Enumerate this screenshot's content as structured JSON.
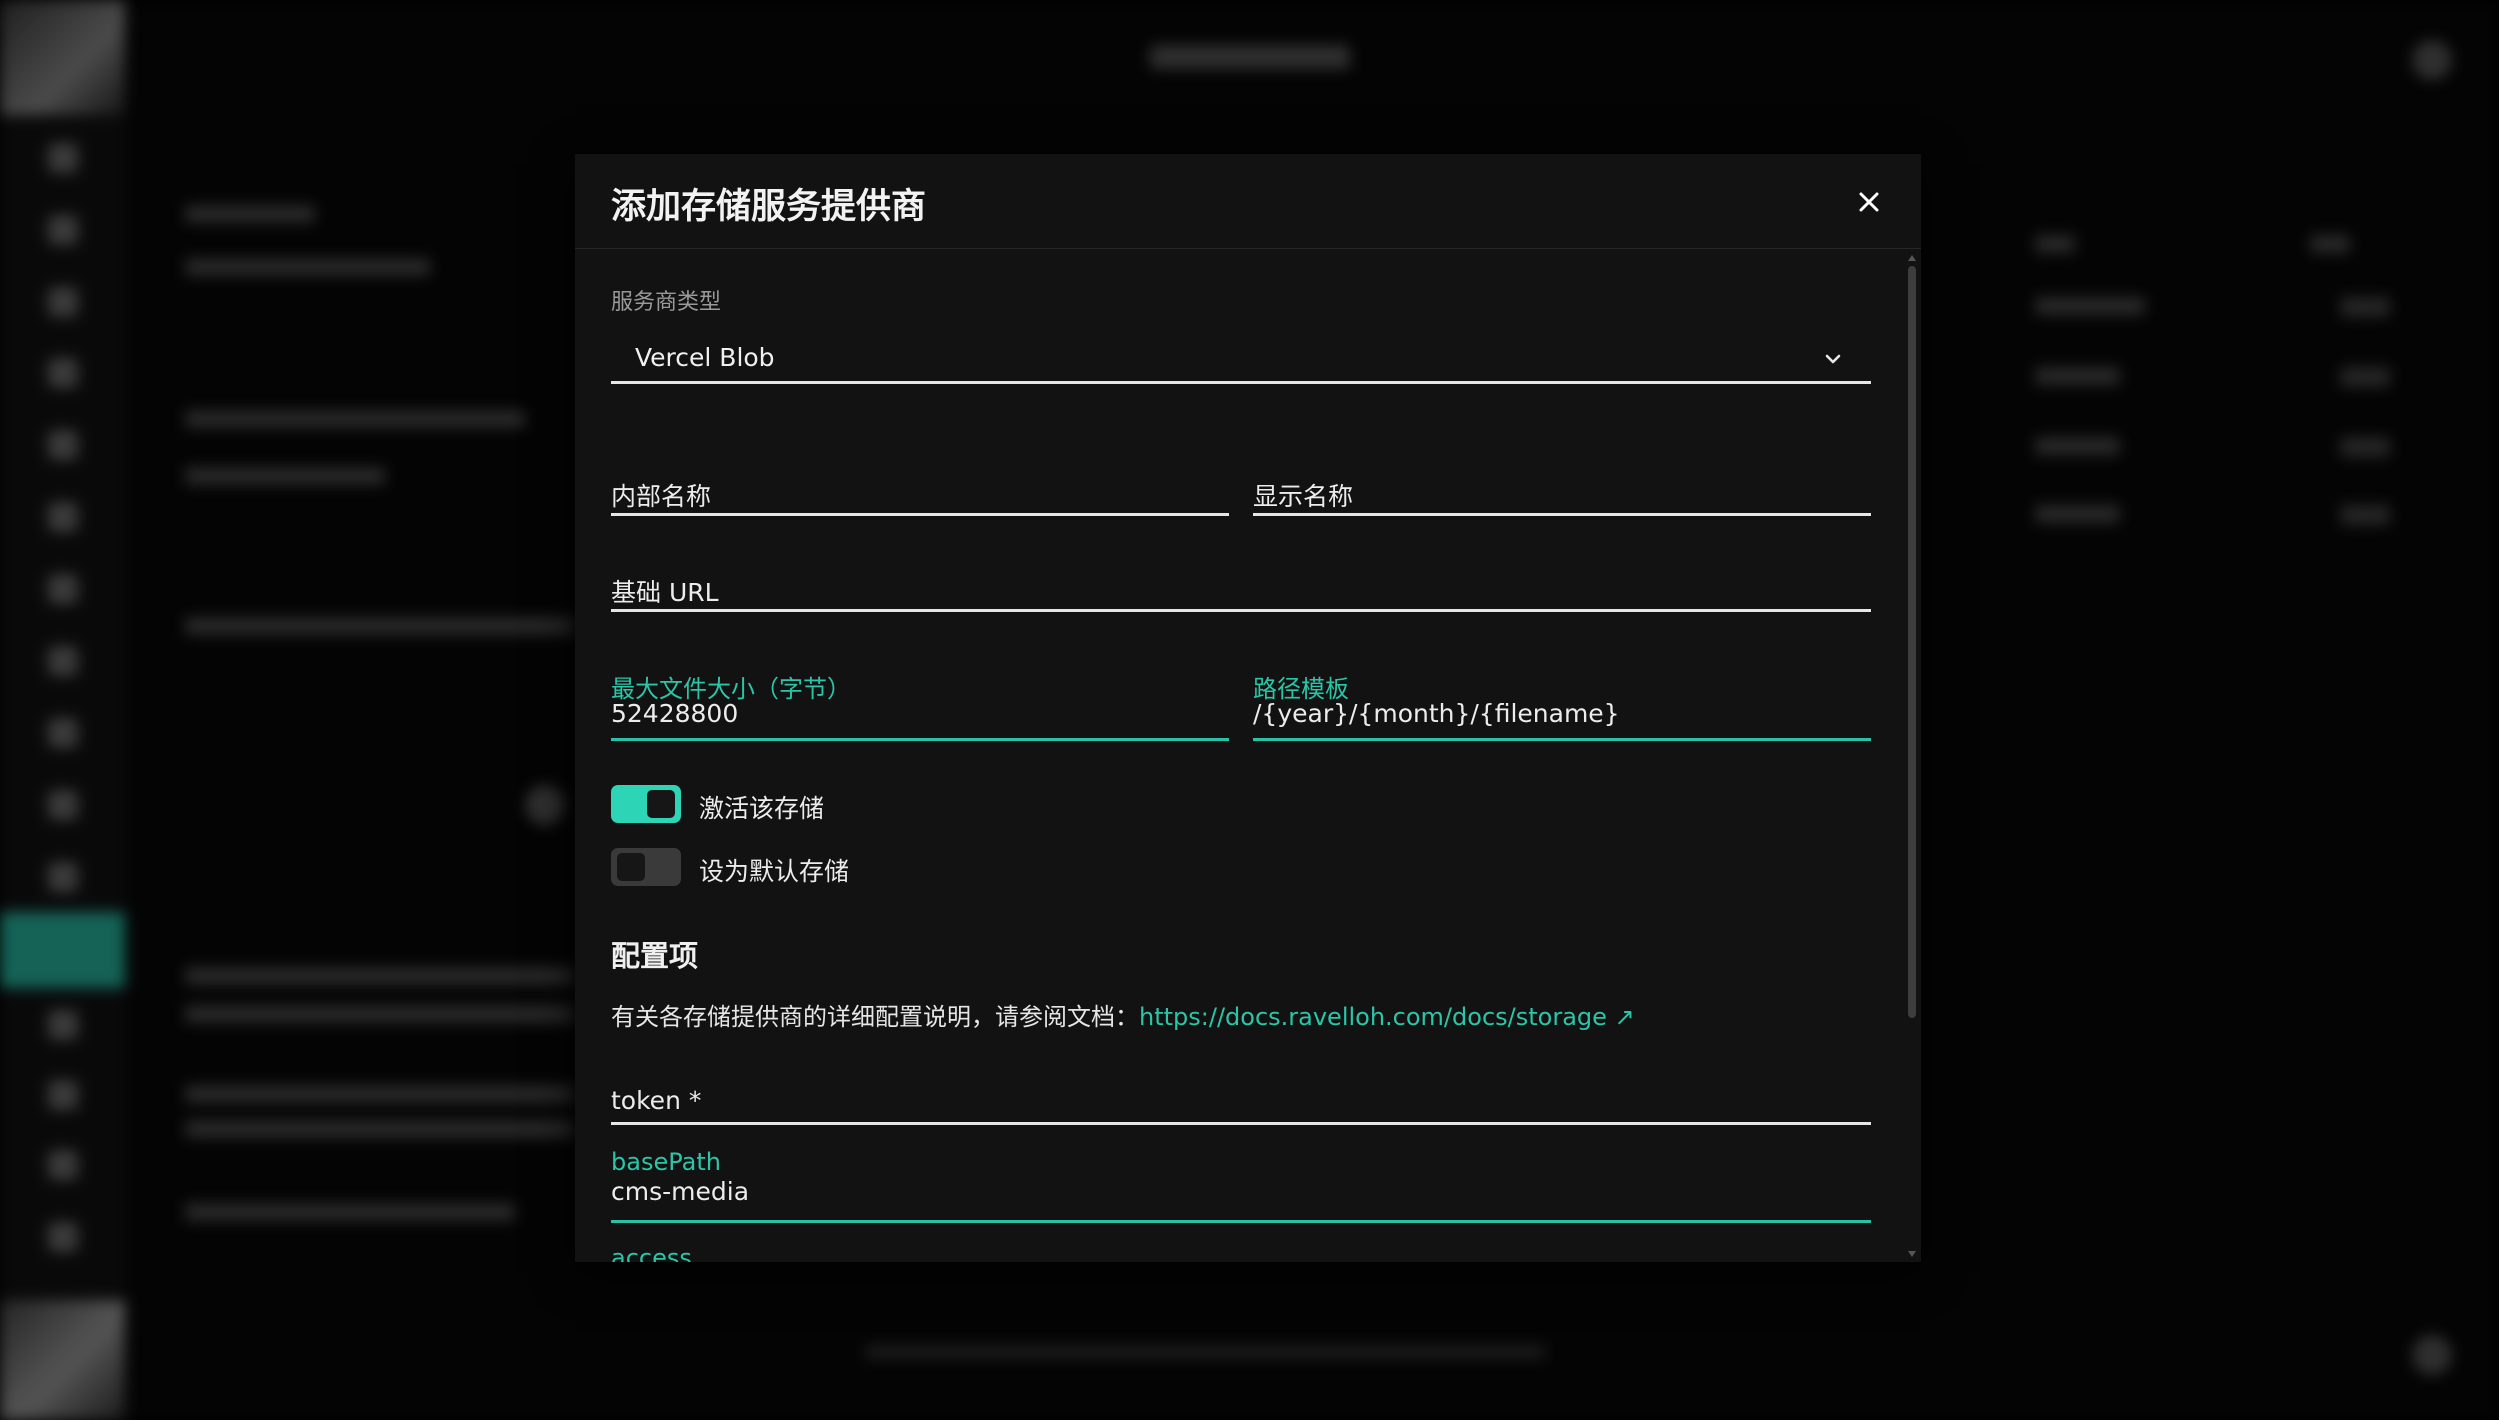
{
  "modal": {
    "title": "添加存储服务提供商",
    "provider_type_label": "服务商类型",
    "provider_type_value": "Vercel Blob",
    "internal_name_label": "内部名称",
    "display_name_label": "显示名称",
    "base_url_label": "基础 URL",
    "max_file_size_label": "最大文件大小（字节）",
    "max_file_size_value": "52428800",
    "path_template_label": "路径模板",
    "path_template_value": "/{year}/{month}/{filename}",
    "activate_label": "激活该存储",
    "activate_on": true,
    "default_label": "设为默认存储",
    "default_on": false,
    "config_section_title": "配置项",
    "docs_text": "有关各存储提供商的详细配置说明，请参阅文档：",
    "docs_link": "https://docs.ravelloh.com/docs/storage ↗",
    "token_label": "token *",
    "basepath_label": "basePath",
    "basepath_value": "cms-media",
    "access_label": "access"
  },
  "colors": {
    "accent": "#2bc5a8",
    "toggle_on": "#2dd4b5",
    "modal_bg": "#121212",
    "backdrop": "#000000"
  },
  "icons": {
    "close": "close-icon",
    "select": "chevron-down-icon",
    "external": "external-link-icon"
  }
}
